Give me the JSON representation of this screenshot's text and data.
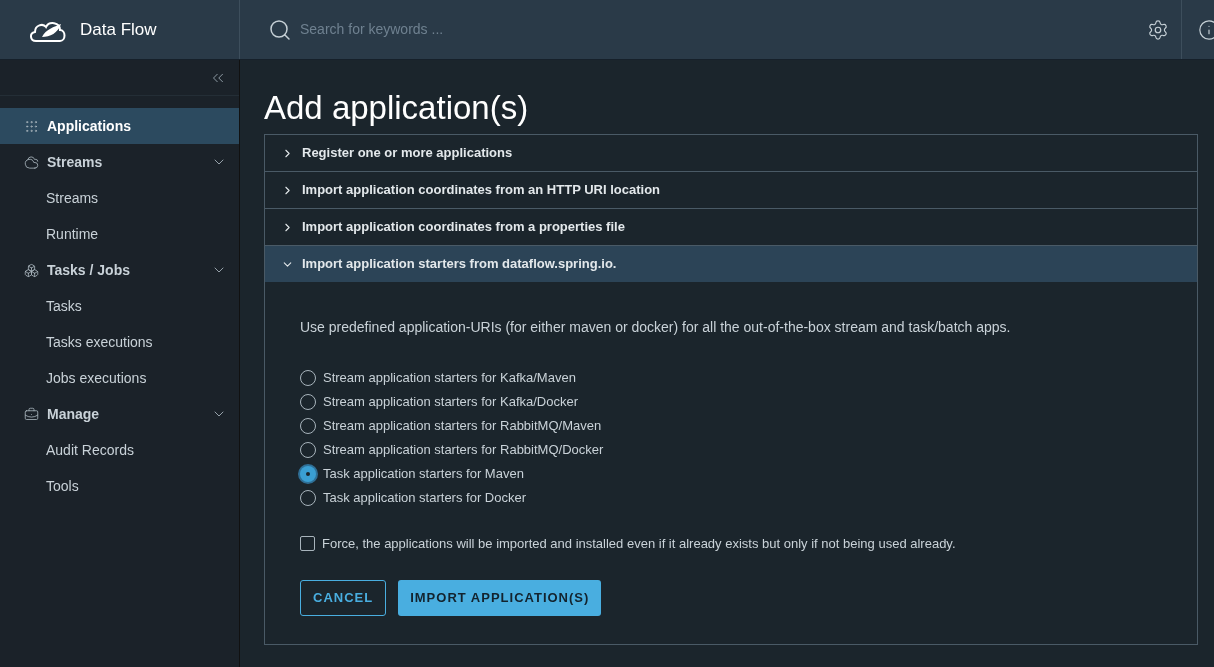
{
  "header": {
    "title": "Data Flow",
    "search": {
      "placeholder": "Search for keywords ..."
    }
  },
  "sidebar": {
    "items": [
      {
        "label": "Applications",
        "selected": true
      },
      {
        "label": "Streams",
        "selected": false,
        "expanded": true,
        "children": [
          {
            "label": "Streams",
            "selected": false
          },
          {
            "label": "Runtime",
            "selected": false
          }
        ]
      },
      {
        "label": "Tasks / Jobs",
        "selected": false,
        "expanded": true,
        "children": [
          {
            "label": "Tasks",
            "selected": false
          },
          {
            "label": "Tasks executions",
            "selected": false
          },
          {
            "label": "Jobs executions",
            "selected": false
          }
        ]
      },
      {
        "label": "Manage",
        "selected": false,
        "expanded": true,
        "children": [
          {
            "label": "Audit Records",
            "selected": false
          },
          {
            "label": "Tools",
            "selected": false
          }
        ]
      }
    ]
  },
  "page": {
    "title": "Add application(s)",
    "panels": [
      {
        "title": "Register one or more applications",
        "expanded": false
      },
      {
        "title": "Import application coordinates from an HTTP URI location",
        "expanded": false
      },
      {
        "title": "Import application coordinates from a properties file",
        "expanded": false
      },
      {
        "title": "Import application starters from dataflow.spring.io.",
        "expanded": true,
        "description": "Use predefined application-URIs (for either maven or docker) for all the out-of-the-box stream and task/batch apps.",
        "options": [
          {
            "label": "Stream application starters for Kafka/Maven",
            "selected": false
          },
          {
            "label": "Stream application starters for Kafka/Docker",
            "selected": false
          },
          {
            "label": "Stream application starters for RabbitMQ/Maven",
            "selected": false
          },
          {
            "label": "Stream application starters for RabbitMQ/Docker",
            "selected": false
          },
          {
            "label": "Task application starters for Maven",
            "selected": true
          },
          {
            "label": "Task application starters for Docker",
            "selected": false
          }
        ],
        "force": {
          "label": "Force, the applications will be imported and installed even if it already exists but only if not being used already.",
          "checked": false
        },
        "buttons": [
          {
            "label": "CANCEL",
            "kind": "outline"
          },
          {
            "label": "IMPORT APPLICATION(S)",
            "kind": "primary"
          }
        ]
      }
    ]
  }
}
